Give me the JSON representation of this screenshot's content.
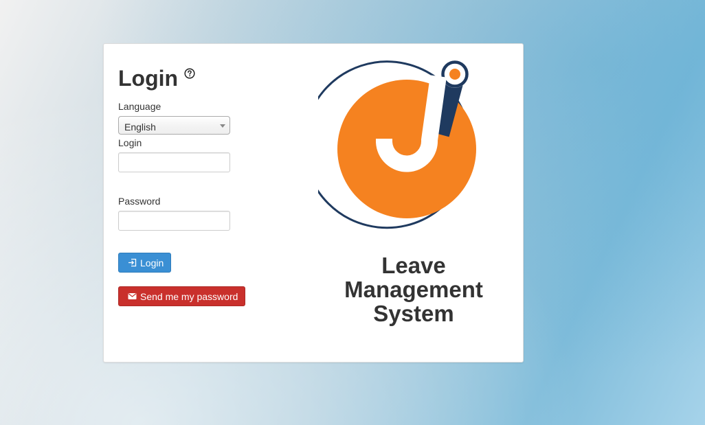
{
  "login_card": {
    "title": "Login",
    "help_icon": "help-circle-icon",
    "language": {
      "label": "Language",
      "selected": "English"
    },
    "login_field": {
      "label": "Login",
      "value": ""
    },
    "password_field": {
      "label": "Password",
      "value": ""
    },
    "login_button": {
      "label": "Login",
      "icon": "sign-in-icon",
      "color": "#3a8fd4"
    },
    "send_password_button": {
      "label": "Send me my password",
      "icon": "envelope-icon",
      "color": "#c9302c"
    }
  },
  "brand": {
    "logo_icon": "jorani-logo-icon",
    "accent_color": "#f58220",
    "ring_color": "#1f3a5f",
    "name_lines": [
      "Leave",
      "Management",
      "System"
    ]
  }
}
